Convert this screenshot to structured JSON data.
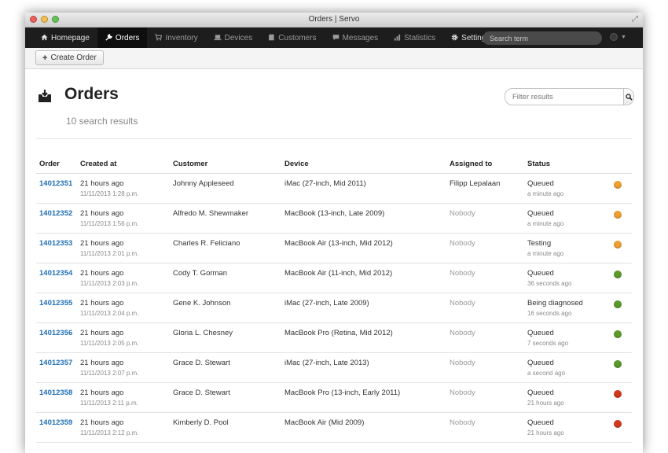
{
  "window": {
    "title": "Orders | Servo"
  },
  "nav": {
    "items": [
      {
        "label": "Homepage",
        "icon": "home-icon",
        "active": false
      },
      {
        "label": "Orders",
        "icon": "wrench-icon",
        "active": true
      },
      {
        "label": "Inventory",
        "icon": "cart-icon",
        "active": false
      },
      {
        "label": "Devices",
        "icon": "laptop-icon",
        "active": false
      },
      {
        "label": "Customers",
        "icon": "book-icon",
        "active": false
      },
      {
        "label": "Messages",
        "icon": "message-icon",
        "active": false
      },
      {
        "label": "Statistics",
        "icon": "bar-chart-icon",
        "active": false
      },
      {
        "label": "Settings",
        "icon": "gear-icon",
        "active": false
      }
    ],
    "search_placeholder": "Search term"
  },
  "toolbar": {
    "create_label": "Create Order"
  },
  "page": {
    "title": "Orders",
    "result_count": "10 search results",
    "filter_placeholder": "Filter results"
  },
  "table": {
    "headers": {
      "order": "Order",
      "created": "Created at",
      "customer": "Customer",
      "device": "Device",
      "assigned": "Assigned to",
      "status": "Status"
    },
    "rows": [
      {
        "order": "14012351",
        "created": "21 hours ago",
        "created_date": "11/11/2013 1:28 p.m.",
        "customer": "Johnny Appleseed",
        "device": "iMac (27-inch, Mid 2011)",
        "assigned": "Filipp Lepalaan",
        "status": "Queued",
        "status_time": "a minute ago",
        "status_color": "#f0a030"
      },
      {
        "order": "14012352",
        "created": "21 hours ago",
        "created_date": "11/11/2013 1:56 p.m.",
        "customer": "Alfredo M. Shewmaker",
        "device": "MacBook (13-inch, Late 2009)",
        "assigned": "Nobody",
        "status": "Queued",
        "status_time": "a minute ago",
        "status_color": "#f0a030"
      },
      {
        "order": "14012353",
        "created": "21 hours ago",
        "created_date": "11/11/2013 2:01 p.m.",
        "customer": "Charles R. Feliciano",
        "device": "MacBook Air (13-inch, Mid 2012)",
        "assigned": "Nobody",
        "status": "Testing",
        "status_time": "a minute ago",
        "status_color": "#f0a030"
      },
      {
        "order": "14012354",
        "created": "21 hours ago",
        "created_date": "11/11/2013 2:03 p.m.",
        "customer": "Cody T. Gorman",
        "device": "MacBook Air (11-inch, Mid 2012)",
        "assigned": "Nobody",
        "status": "Queued",
        "status_time": "36 seconds ago",
        "status_color": "#5a9a2a"
      },
      {
        "order": "14012355",
        "created": "21 hours ago",
        "created_date": "11/11/2013 2:04 p.m.",
        "customer": "Gene K. Johnson",
        "device": "iMac (27-inch, Late 2009)",
        "assigned": "Nobody",
        "status": "Being diagnosed",
        "status_time": "16 seconds ago",
        "status_color": "#5a9a2a"
      },
      {
        "order": "14012356",
        "created": "21 hours ago",
        "created_date": "11/11/2013 2:05 p.m.",
        "customer": "Gloria L. Chesney",
        "device": "MacBook Pro (Retina, Mid 2012)",
        "assigned": "Nobody",
        "status": "Queued",
        "status_time": "7 seconds ago",
        "status_color": "#5a9a2a"
      },
      {
        "order": "14012357",
        "created": "21 hours ago",
        "created_date": "11/11/2013 2:07 p.m.",
        "customer": "Grace D. Stewart",
        "device": "iMac (27-inch, Late 2013)",
        "assigned": "Nobody",
        "status": "Queued",
        "status_time": "a second ago",
        "status_color": "#5a9a2a"
      },
      {
        "order": "14012358",
        "created": "21 hours ago",
        "created_date": "11/11/2013 2:11 p.m.",
        "customer": "Grace D. Stewart",
        "device": "MacBook Pro (13-inch, Early 2011)",
        "assigned": "Nobody",
        "status": "Queued",
        "status_time": "21 hours ago",
        "status_color": "#d23a1e"
      },
      {
        "order": "14012359",
        "created": "21 hours ago",
        "created_date": "11/11/2013 2:12 p.m.",
        "customer": "Kimberly D. Pool",
        "device": "MacBook Air (Mid 2009)",
        "assigned": "Nobody",
        "status": "Queued",
        "status_time": "21 hours ago",
        "status_color": "#d23a1e"
      }
    ]
  }
}
